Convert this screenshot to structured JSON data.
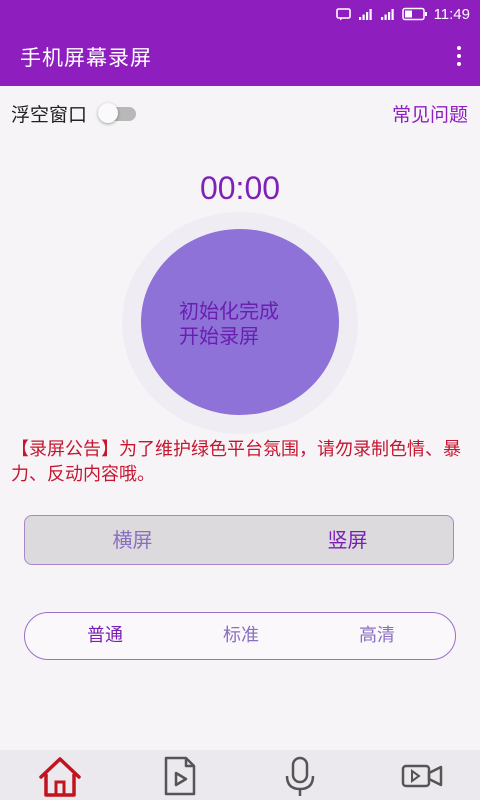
{
  "status_bar": {
    "time": "11:49",
    "icons": [
      "notification-icon",
      "signal-icon",
      "signal-icon",
      "battery-icon"
    ]
  },
  "app_bar": {
    "title": "手机屏幕录屏",
    "menu_icon": "overflow-menu-icon"
  },
  "floating_window": {
    "label": "浮空窗口",
    "enabled": false
  },
  "faq": {
    "label": "常见问题"
  },
  "timer": {
    "value": "00:00"
  },
  "record_button": {
    "line1": "初始化完成",
    "line2": "开始录屏"
  },
  "notice": {
    "text": "【录屏公告】为了维护绿色平台氛围，请勿录制色情、暴力、反动内容哦。"
  },
  "orientation": {
    "options": [
      "横屏",
      "竖屏"
    ],
    "selected": "竖屏"
  },
  "quality": {
    "options": [
      "普通",
      "标准",
      "高清"
    ],
    "selected": "普通"
  },
  "bottom_nav": {
    "items": [
      {
        "icon": "home-icon",
        "active": true
      },
      {
        "icon": "video-file-icon",
        "active": false
      },
      {
        "icon": "microphone-icon",
        "active": false
      },
      {
        "icon": "video-camera-icon",
        "active": false
      }
    ]
  },
  "colors": {
    "primary": "#8e1fbe",
    "record_button": "#8e72d8",
    "notice": "#c4162f",
    "nav_active": "#c0141e"
  }
}
